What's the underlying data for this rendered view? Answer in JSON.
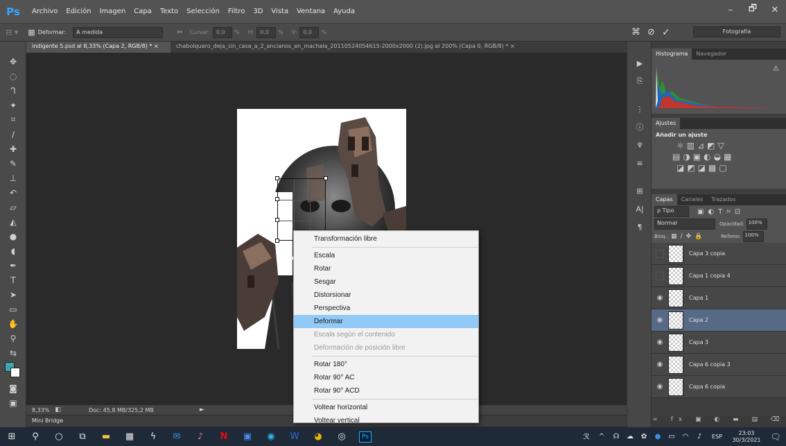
{
  "app": {
    "logo": "Ps",
    "accent": "#31a8ff"
  },
  "menu": [
    "Archivo",
    "Edición",
    "Imagen",
    "Capa",
    "Texto",
    "Selección",
    "Filtro",
    "3D",
    "Vista",
    "Ventana",
    "Ayuda"
  ],
  "window_controls": {
    "minimize": "–",
    "restore": "🗗",
    "close": "✕"
  },
  "options": {
    "mode_label": "Deformar:",
    "mode_value": "A medida",
    "curve_label": "Curvar:",
    "curve_value": "0,0",
    "h_label": "H:",
    "h_value": "0,0",
    "v_label": "V:",
    "v_value": "0,0",
    "pct": "%",
    "workspace": "Fotografía"
  },
  "doc_tabs": [
    "indigente 5.psd al 8,33% (Capa 2, RGB/8) * ×",
    "chabolquero_deja_sin_casa_a_2_ancianos_en_machala_20110524054615-2000x2000 (2).jpg al 200% (Capa 0, RGB/8) * ×"
  ],
  "status": {
    "zoom": "8,33%",
    "doc": "Doc: 45,8 MB/325,2 MB"
  },
  "minibridge": "Mini Bridge",
  "histogram": {
    "tabs": [
      "Histograma",
      "Navegador"
    ]
  },
  "adjustments": {
    "tab": "Ajustes",
    "title": "Añadir un ajuste"
  },
  "layers_panel": {
    "tabs": [
      "Capas",
      "Canales",
      "Trazados"
    ],
    "filter": "ρ Tipo",
    "blend": "Normal",
    "opacity_label": "Opacidad:",
    "opacity_value": "100%",
    "lock_label": "Bloq.:",
    "fill_label": "Relleno:",
    "fill_value": "100%",
    "layers": [
      {
        "name": "Capa 3 copia",
        "visible": false,
        "selected": false
      },
      {
        "name": "Capa 1 copia 4",
        "visible": false,
        "selected": false
      },
      {
        "name": "Capa 1",
        "visible": true,
        "selected": false
      },
      {
        "name": "Capa 2",
        "visible": true,
        "selected": true
      },
      {
        "name": "Capa 3",
        "visible": true,
        "selected": false
      },
      {
        "name": "Capa 6 copia 3",
        "visible": true,
        "selected": false
      },
      {
        "name": "Capa 6 copia",
        "visible": true,
        "selected": false
      }
    ]
  },
  "context_menu": [
    {
      "label": "Transformación libre",
      "state": "normal"
    },
    {
      "sep": true
    },
    {
      "label": "Escala",
      "state": "normal"
    },
    {
      "label": "Rotar",
      "state": "normal"
    },
    {
      "label": "Sesgar",
      "state": "normal"
    },
    {
      "label": "Distorsionar",
      "state": "normal"
    },
    {
      "label": "Perspectiva",
      "state": "normal"
    },
    {
      "label": "Deformar",
      "state": "highlighted"
    },
    {
      "label": "Escala según el contenido",
      "state": "disabled"
    },
    {
      "label": "Deformación de posición libre",
      "state": "disabled"
    },
    {
      "sep": true
    },
    {
      "label": "Rotar 180°",
      "state": "normal"
    },
    {
      "label": "Rotar 90° AC",
      "state": "normal"
    },
    {
      "label": "Rotar 90° ACD",
      "state": "normal"
    },
    {
      "sep": true
    },
    {
      "label": "Voltear horizontal",
      "state": "normal"
    },
    {
      "label": "Voltear vertical",
      "state": "normal"
    }
  ],
  "taskbar": {
    "lang": "ESP",
    "time": "23:03",
    "date": "30/3/2021",
    "ps_label": "Ps"
  }
}
